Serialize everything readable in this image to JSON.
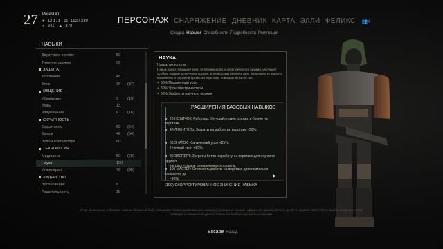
{
  "player": {
    "level": "27",
    "name": "PeresDD",
    "health": "12 171",
    "carry": "192 / 230",
    "bits": "341",
    "ammo": "370"
  },
  "nav": {
    "tabs": [
      "ПЕРСОНАЖ",
      "СНАРЯЖЕНИЕ",
      "ДНЕВНИК",
      "КАРТА",
      "ЭЛЛИ",
      "ФЕЛИКС"
    ],
    "active": 0,
    "people_count": "4",
    "subtabs": [
      "Сводка",
      "Навыки",
      "Способности",
      "Подробности",
      "Репутация"
    ],
    "active_sub": 1
  },
  "skills": {
    "header": "НАВЫКИ",
    "rows": [
      {
        "name": "Двуручное оружие",
        "v1": "50",
        "v2": "",
        "cat": false
      },
      {
        "name": "Тяжелое оружие",
        "v1": "50",
        "v2": "",
        "cat": false
      },
      {
        "name": "ЗАЩИТА",
        "v1": "",
        "v2": "",
        "cat": true
      },
      {
        "name": "Уклонение",
        "v1": "48",
        "v2": "",
        "cat": false
      },
      {
        "name": "Блок",
        "v1": "36",
        "v2": "(37)",
        "cat": false
      },
      {
        "name": "ОБЩЕНИЕ",
        "v1": "",
        "v2": "",
        "cat": true
      },
      {
        "name": "Убеждение",
        "v1": "9",
        "v2": "(19)",
        "cat": false
      },
      {
        "name": "Ложь",
        "v1": "13",
        "v2": "",
        "cat": false
      },
      {
        "name": "Запугивание",
        "v1": "6",
        "v2": "(16)",
        "cat": false
      },
      {
        "name": "СКРЫТНОСТЬ",
        "v1": "",
        "v2": "",
        "cat": true
      },
      {
        "name": "Скрытность",
        "v1": "60",
        "v2": "(64)",
        "cat": false
      },
      {
        "name": "Взлом",
        "v1": "46",
        "v2": "(54)",
        "cat": false
      },
      {
        "name": "Взлом компьютера",
        "v1": "60",
        "v2": "",
        "cat": false
      },
      {
        "name": "ТЕХНОЛОГИЯ",
        "v1": "",
        "v2": "",
        "cat": true
      },
      {
        "name": "Медицина",
        "v1": "50",
        "v2": "(60)",
        "cat": false
      },
      {
        "name": "Наука",
        "v1": "100",
        "v2": "",
        "cat": false
      },
      {
        "name": "Инженерия",
        "v1": "76",
        "v2": "(96)",
        "cat": false
      },
      {
        "name": "ЛИДЕРСТВО",
        "v1": "",
        "v2": "",
        "cat": true
      },
      {
        "name": "Вдохновение",
        "v1": "8",
        "v2": "",
        "cat": false
      },
      {
        "name": "Решительность",
        "v1": "16",
        "v2": "",
        "cat": false
      }
    ],
    "selected": 15
  },
  "detail": {
    "title": "НАУКА",
    "subtitle": "Навык технологии",
    "text": "Навык науки повышает урон от плазменного и электрического оружия, улучшает особые эффекты научного оружия, а на высоких уровнях дает возможность вносить изменения в оружие и броню на верстаке, повышая их качество.",
    "bonuses": [
      "30% Плазменный урон",
      "30% Урон электричеством",
      "50% Эффекты научного оружия"
    ],
    "upgrades_title": "РАСШИРЕНИЯ БАЗОВЫХ НАВЫКОВ",
    "upgrades": [
      {
        "head": "20 НОВИЧОК:",
        "text": "Работать. Улучшайте свое оружие и броню на верстаке.",
        "cont": ""
      },
      {
        "head": "40 ЛЮБИТЕЛЬ:",
        "text": "Затраты на работу на верстаке: -50%.",
        "cont": ""
      },
      {
        "head": "60 ЗНАТОК:",
        "text": "Критический урон +25%.",
        "cont": "Н-ичный урон +25%."
      },
      {
        "head": "80 ЭКСПЕРТ:",
        "text": "Затраты битов на работу на верстаке для научного оружия",
        "cont": "не растут выше определенного предела."
      },
      {
        "head": "100 МАСТЕР:",
        "text": "Стоимость работы на верстаке дополнительно снижается до",
        "cont": "-90%."
      }
    ],
    "corrected": "(100) СКОРРЕКТИРОВАННОЕ ЗНАЧЕНИЕ НАВЫКА"
  },
  "footer": {
    "info": "Очки, вложенные в базовые навыки (Ближний бой), повышают специализированные навыки (рукопашное оружие, двуручное оружие) вплоть до 50-го уровня. После 50-го уровня вложение очков приводит к повышению уровня только в специализированных навыках.",
    "escape_key": "Escape",
    "escape_label": "Назад"
  },
  "colors": {
    "accent": "#7da3ad",
    "bonus_green": "#7fbf55",
    "active_text": "#f0ebde"
  }
}
